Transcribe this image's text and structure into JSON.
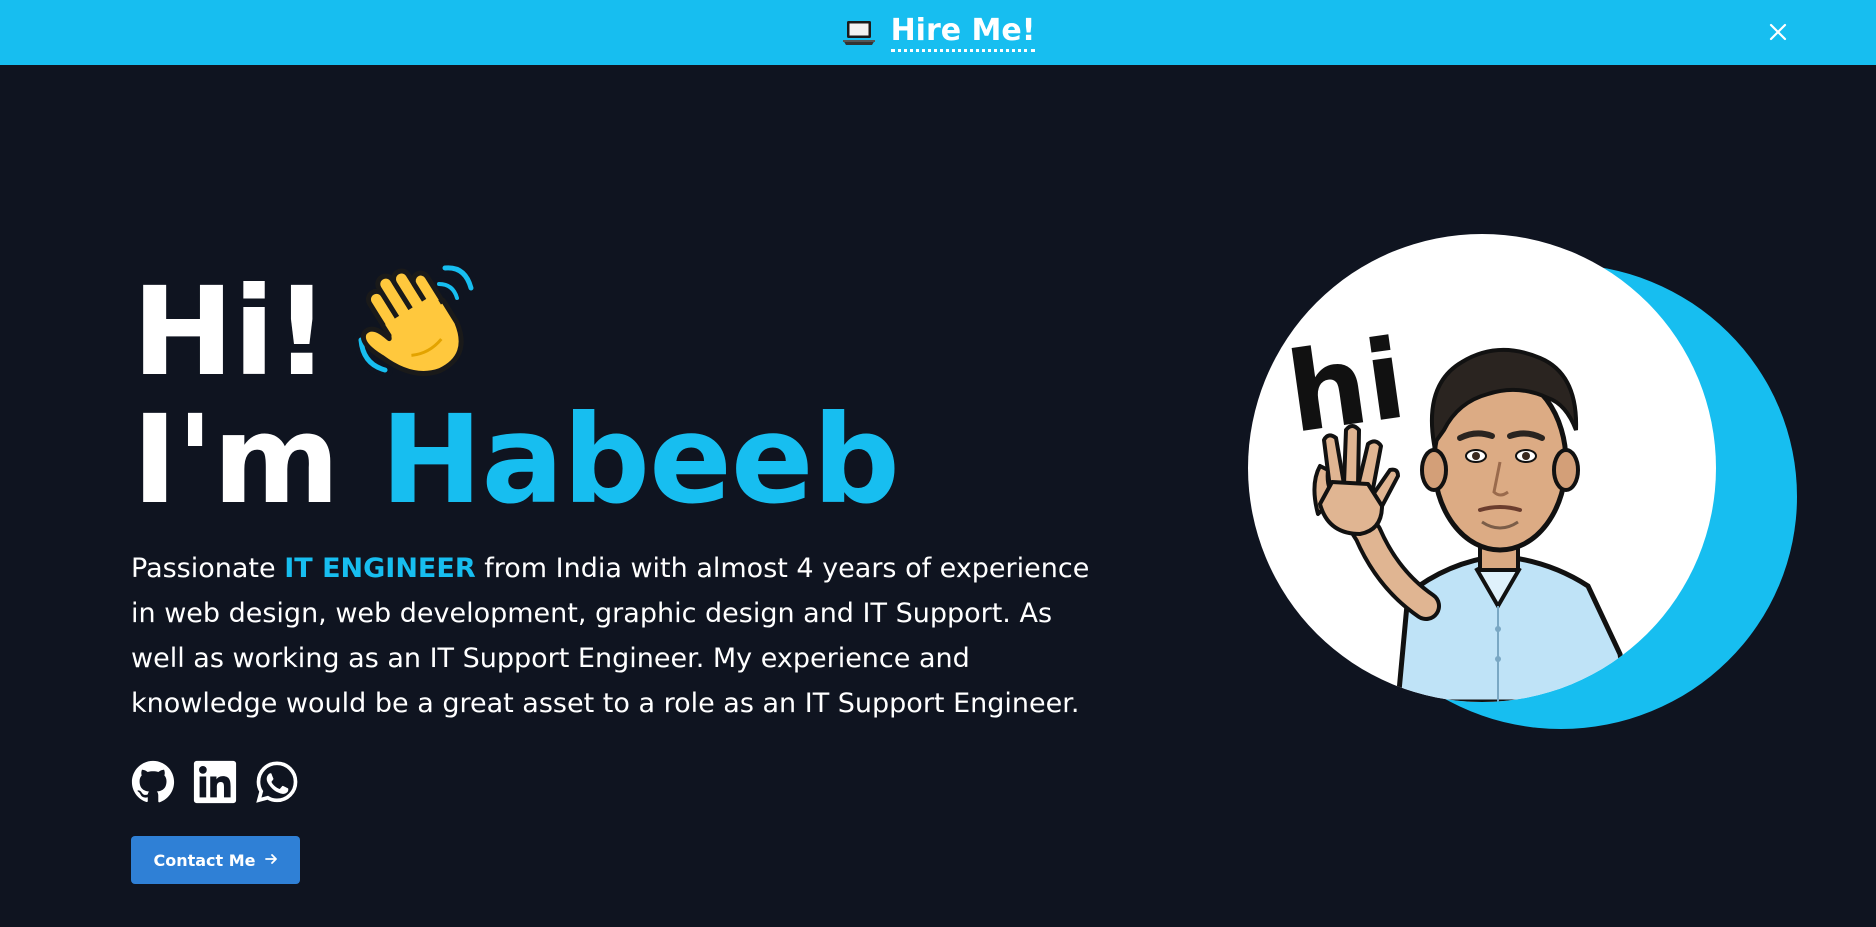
{
  "banner": {
    "link_label": "Hire Me!",
    "icon": "laptop-icon",
    "close_icon": "close-icon",
    "background": "#17bef0"
  },
  "hero": {
    "greeting": "Hi!",
    "wave_icon": "waving-hand-icon",
    "intro_prefix": "I'm",
    "name": "Habeeb",
    "accent_color": "#17bef0",
    "description_prefix": "Passionate",
    "description_highlight": "IT ENGINEER",
    "description_suffix": "from India with almost 4 years of experience in web design, web development, graphic design and IT Support. As well as working as an IT Support Engineer. My experience and knowledge would be a great asset to a role as an IT Support Engineer."
  },
  "socials": [
    {
      "icon": "github-icon"
    },
    {
      "icon": "linkedin-icon"
    },
    {
      "icon": "whatsapp-icon"
    }
  ],
  "contact_button": {
    "label": "Contact Me",
    "icon": "arrow-right-icon",
    "background": "#2f80d6"
  },
  "avatar": {
    "sticker_text": "hi",
    "accent_color": "#17bef0"
  },
  "theme": {
    "background": "#0f1420",
    "text": "#ffffff"
  }
}
